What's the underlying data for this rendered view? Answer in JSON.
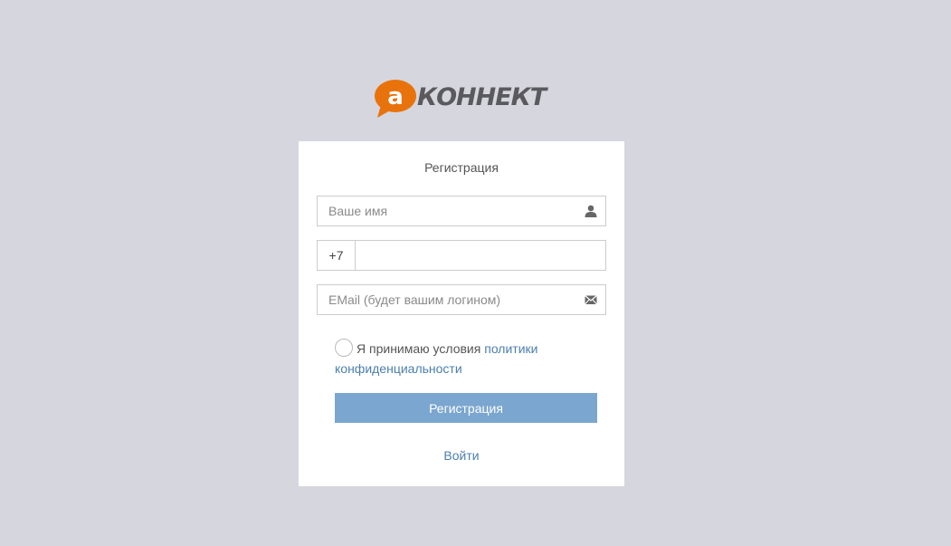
{
  "logo": {
    "letter": "а",
    "wordmark": "КОННЕКТ",
    "bubble_color": "#e8730c"
  },
  "form": {
    "title": "Регистрация",
    "name_placeholder": "Ваше имя",
    "phone_prefix": "+7",
    "phone_value": "",
    "email_placeholder": "EMail (будет вашим логином)",
    "consent_text": "Я принимаю условия ",
    "consent_link": "политики конфиденциальности",
    "submit_label": "Регистрация",
    "login_link": "Войти"
  },
  "icons": {
    "name_field": "user-icon",
    "email_field": "envelope-icon"
  },
  "colors": {
    "background": "#d6d6de",
    "button": "#7ba6cf",
    "link": "#4b7fae"
  }
}
